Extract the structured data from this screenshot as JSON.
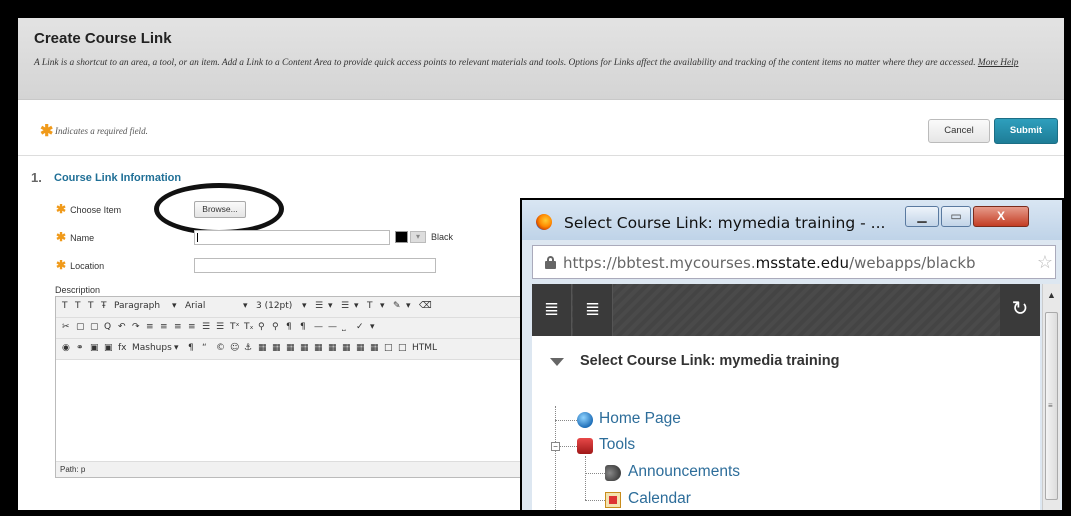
{
  "form": {
    "title": "Create Course Link",
    "description": "A Link is a shortcut to an area, a tool, or an item. Add a Link to a Content Area to provide quick access points to relevant materials and tools. Options for Links affect the availability and tracking of the content items no matter where they are accessed.",
    "more_help": "More Help",
    "required_note": "Indicates a required field.",
    "cancel_label": "Cancel",
    "submit_label": "Submit",
    "section_number": "1.",
    "section_title": "Course Link Information",
    "choose_item_label": "Choose Item",
    "browse_label": "Browse...",
    "name_label": "Name",
    "name_value": "",
    "color_name": "Black",
    "location_label": "Location",
    "location_value": "",
    "description_label": "Description"
  },
  "editor": {
    "row1": [
      "T",
      "T",
      "T",
      "Ŧ",
      "Paragraph",
      "▾",
      "Arial",
      "▾",
      "3 (12pt)",
      "▾",
      "☰",
      "▾",
      "☰",
      "▾",
      "T",
      "▾",
      "✎",
      "▾",
      "⌫"
    ],
    "row2": [
      "✂",
      "▢",
      "▢",
      "Q",
      "↶",
      "↷",
      "≡",
      "≡",
      "≡",
      "≡",
      "☰",
      "☰",
      "Tˣ",
      "Tₓ",
      "⚲",
      "⚲",
      "¶",
      "¶",
      "—",
      "—",
      "⎵",
      "✓",
      "▾"
    ],
    "row3": [
      "◉",
      "⚭",
      "▣",
      "▣",
      "fx",
      "Mashups",
      "▾",
      "¶",
      "“",
      "©",
      "☺",
      "⚓",
      "▦",
      "▦",
      "▦",
      "▦",
      "▦",
      "▦",
      "▦",
      "▦",
      "▦",
      "□",
      "□",
      "HTML"
    ],
    "path_label": "Path: p"
  },
  "popup": {
    "window_title": "Select Course Link: mymedia training - ...",
    "url_prefix": "https://bbtest.mycourses.",
    "url_domain": "msstate.edu",
    "url_suffix": "/webapps/blackb",
    "tree_title": "Select Course Link: mymedia training",
    "nodes": {
      "home": "Home Page",
      "tools": "Tools",
      "announcements": "Announcements",
      "calendar": "Calendar"
    },
    "min_glyph": "▁",
    "max_glyph": "▭",
    "close_glyph": "X",
    "menu_glyph_1": "≣",
    "menu_glyph_2": "≣",
    "refresh_glyph": "↻",
    "star_glyph": "☆",
    "tree_minus": "−"
  },
  "colors": {
    "accent": "#1f7d97",
    "required_star": "#f09a1a",
    "link_blue": "#2d6d9a",
    "section_title": "#1f6f96"
  }
}
